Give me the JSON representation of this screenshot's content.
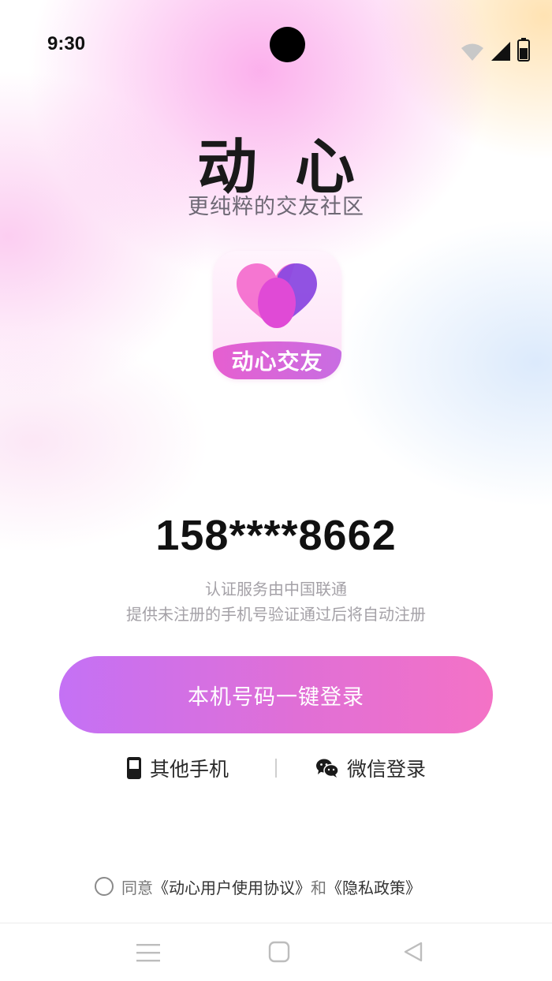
{
  "status_bar": {
    "time": "9:30",
    "icons": [
      "wifi-icon",
      "signal-icon",
      "battery-icon"
    ]
  },
  "header": {
    "title": "动心",
    "subtitle": "更纯粹的交友社区"
  },
  "app_icon": {
    "label": "动心交友",
    "colors": {
      "heart_left": "#f46fcf",
      "heart_right": "#8b49e0",
      "heart_center": "#e04ad6"
    }
  },
  "login": {
    "phone_number": "158****8662",
    "auth_provider_text": "认证服务由中国联通",
    "register_note": "提供未注册的手机号验证通过后将自动注册",
    "one_click_button": "本机号码一键登录",
    "other_phone": "其他手机",
    "wechat_login": "微信登录"
  },
  "agreement": {
    "agree_prefix": "同意",
    "user_agreement": "《动心用户使用协议》",
    "conjunction": "和",
    "privacy_policy": "《隐私政策》",
    "checked": false
  },
  "nav_bar": {
    "icons": [
      "menu-icon",
      "home-icon",
      "back-icon"
    ]
  },
  "colors": {
    "button_gradient_start": "#c471f5",
    "button_gradient_end": "#f472c6"
  }
}
